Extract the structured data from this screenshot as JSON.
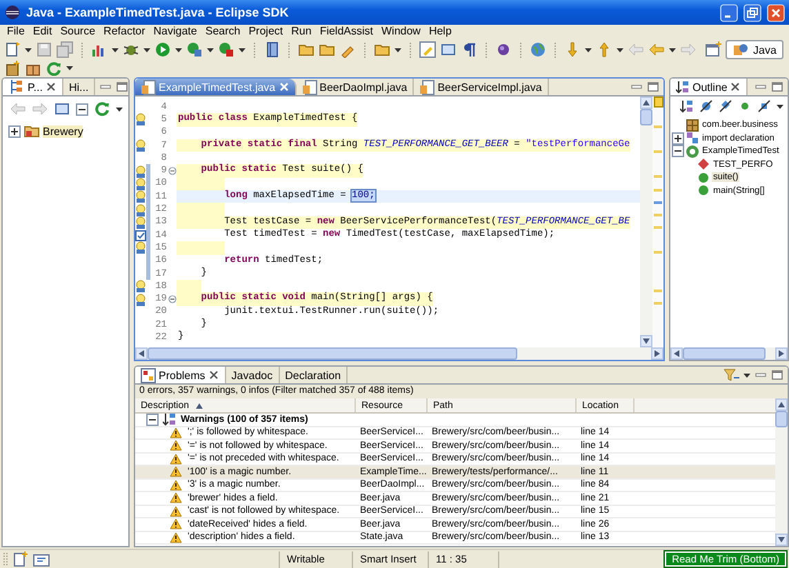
{
  "window": {
    "title": "Java - ExampleTimedTest.java - Eclipse SDK"
  },
  "menu": [
    "File",
    "Edit",
    "Source",
    "Refactor",
    "Navigate",
    "Search",
    "Project",
    "Run",
    "FieldAssist",
    "Window",
    "Help"
  ],
  "perspective": {
    "label": "Java",
    "selected": true
  },
  "package_explorer": {
    "tabs": [
      {
        "label": "P...",
        "selected": true
      },
      {
        "label": "Hi...",
        "selected": false
      }
    ],
    "tree": [
      {
        "label": "Brewery",
        "expanded": false,
        "selected": true
      }
    ]
  },
  "editor": {
    "tabs": [
      {
        "label": "ExampleTimedTest.java",
        "selected": true
      },
      {
        "label": "BeerDaoImpl.java",
        "selected": false
      },
      {
        "label": "BeerServiceImpl.java",
        "selected": false
      }
    ],
    "lines": [
      {
        "number": "4",
        "warning": false,
        "current": false,
        "warning_marker": false,
        "task_marker": false,
        "fold": false,
        "in_range": false
      },
      {
        "number": "5",
        "warning": true,
        "current": false,
        "warning_marker": true,
        "task_marker": false,
        "fold": false,
        "in_range": false,
        "kind": "class",
        "segments": [
          {
            "text": "public class",
            "kind": "keyword"
          },
          {
            "text": " ExampleTimedTest {",
            "kind": "plain"
          }
        ]
      },
      {
        "number": "6",
        "warning": false,
        "current": false,
        "warning_marker": false,
        "task_marker": false,
        "fold": false,
        "in_range": false
      },
      {
        "number": "7",
        "warning": true,
        "current": false,
        "warning_marker": true,
        "task_marker": false,
        "fold": false,
        "in_range": false,
        "kind": "member",
        "segments": [
          {
            "text": "private static final",
            "kind": "keyword"
          },
          {
            "text": " String ",
            "kind": "plain"
          },
          {
            "text": "TEST_PERFORMANCE_GET_BEER",
            "kind": "constant"
          },
          {
            "text": " = ",
            "kind": "plain"
          },
          {
            "text": "\"testPerformanceGe",
            "kind": "string"
          }
        ]
      },
      {
        "number": "8",
        "warning": false,
        "current": false,
        "warning_marker": false,
        "task_marker": false,
        "fold": false,
        "in_range": false
      },
      {
        "number": "9",
        "warning": true,
        "current": false,
        "warning_marker": true,
        "task_marker": false,
        "fold": true,
        "in_range": true,
        "kind": "member",
        "segments": [
          {
            "text": "public static",
            "kind": "keyword"
          },
          {
            "text": " Test suite() {",
            "kind": "plain"
          }
        ]
      },
      {
        "number": "10",
        "warning": true,
        "current": false,
        "warning_marker": true,
        "task_marker": false,
        "fold": false,
        "in_range": true,
        "kind": "statement"
      },
      {
        "number": "11",
        "warning": false,
        "current": true,
        "warning_marker": true,
        "task_marker": false,
        "fold": false,
        "in_range": true,
        "kind": "statement",
        "segments": [
          {
            "text": "long",
            "kind": "keyword"
          },
          {
            "text": " maxElapsedTime = ",
            "kind": "plain"
          },
          {
            "text": "100;",
            "kind": "selected"
          }
        ]
      },
      {
        "number": "12",
        "warning": true,
        "current": false,
        "warning_marker": true,
        "task_marker": false,
        "fold": false,
        "in_range": true,
        "kind": "statement"
      },
      {
        "number": "13",
        "warning": true,
        "current": false,
        "warning_marker": true,
        "task_marker": false,
        "fold": false,
        "in_range": true,
        "kind": "statement",
        "segments": [
          {
            "text": "Test testCase = ",
            "kind": "plain"
          },
          {
            "text": "new",
            "kind": "keyword"
          },
          {
            "text": " BeerServicePerformanceTest(",
            "kind": "plain"
          },
          {
            "text": "TEST_PERFORMANCE_GET_BE",
            "kind": "constant"
          }
        ]
      },
      {
        "number": "14",
        "warning": false,
        "current": false,
        "warning_marker": false,
        "task_marker": true,
        "fold": false,
        "in_range": true,
        "kind": "statement",
        "segments": [
          {
            "text": "Test timedTest = ",
            "kind": "plain"
          },
          {
            "text": "new",
            "kind": "keyword"
          },
          {
            "text": " TimedTest(testCase, maxElapsedTime);",
            "kind": "plain"
          }
        ]
      },
      {
        "number": "15",
        "warning": true,
        "current": false,
        "warning_marker": true,
        "task_marker": false,
        "fold": false,
        "in_range": true,
        "kind": "statement"
      },
      {
        "number": "16",
        "warning": false,
        "current": false,
        "warning_marker": false,
        "task_marker": false,
        "fold": false,
        "in_range": true,
        "kind": "statement",
        "segments": [
          {
            "text": "return",
            "kind": "keyword"
          },
          {
            "text": " timedTest;",
            "kind": "plain"
          }
        ]
      },
      {
        "number": "17",
        "warning": false,
        "current": false,
        "warning_marker": false,
        "task_marker": false,
        "fold": false,
        "in_range": true,
        "kind": "member",
        "segments": [
          {
            "text": "}",
            "kind": "plain"
          }
        ]
      },
      {
        "number": "18",
        "warning": true,
        "current": false,
        "warning_marker": true,
        "task_marker": false,
        "fold": false,
        "in_range": false,
        "kind": "member"
      },
      {
        "number": "19",
        "warning": true,
        "current": false,
        "warning_marker": true,
        "task_marker": false,
        "fold": true,
        "in_range": false,
        "kind": "member",
        "segments": [
          {
            "text": "public static void",
            "kind": "keyword"
          },
          {
            "text": " main(String[] args) {",
            "kind": "plain"
          }
        ]
      },
      {
        "number": "20",
        "warning": false,
        "current": false,
        "warning_marker": false,
        "task_marker": false,
        "fold": false,
        "in_range": false,
        "kind": "statement",
        "segments": [
          {
            "text": "junit.textui.TestRunner.run(suite());",
            "kind": "plain"
          }
        ]
      },
      {
        "number": "21",
        "warning": false,
        "current": false,
        "warning_marker": false,
        "task_marker": false,
        "fold": false,
        "in_range": false,
        "kind": "member",
        "segments": [
          {
            "text": "}",
            "kind": "plain"
          }
        ]
      },
      {
        "number": "22",
        "warning": false,
        "current": false,
        "warning_marker": false,
        "task_marker": false,
        "fold": false,
        "in_range": false,
        "kind": "class",
        "segments": [
          {
            "text": "}",
            "kind": "plain"
          }
        ]
      }
    ]
  },
  "outline": {
    "tabs": [
      {
        "label": "Outline",
        "selected": true
      }
    ],
    "tree": [
      {
        "label": "com.beer.business",
        "kind": "package",
        "selected": false
      },
      {
        "label": "import declaration",
        "kind": "imports",
        "expanded": false,
        "selected": false
      },
      {
        "label": "ExampleTimedTest",
        "kind": "class",
        "expanded": true,
        "selected": false,
        "children": [
          {
            "label": "TEST_PERFO",
            "kind": "field",
            "selected": false
          },
          {
            "label": "suite()",
            "kind": "method",
            "selected": true
          },
          {
            "label": "main(String[]",
            "kind": "method",
            "selected": false
          }
        ]
      }
    ]
  },
  "problems": {
    "tabs": [
      {
        "label": "Problems",
        "selected": true
      },
      {
        "label": "Javadoc",
        "selected": false
      },
      {
        "label": "Declaration",
        "selected": false
      }
    ],
    "summary": "0 errors, 357 warnings, 0 infos (Filter matched 357 of 488 items)",
    "columns": [
      {
        "label": "Description",
        "sorted": true
      },
      {
        "label": "Resource",
        "sorted": false
      },
      {
        "label": "Path",
        "sorted": false
      },
      {
        "label": "Location",
        "sorted": false
      }
    ],
    "groups": [
      {
        "label": "Warnings (100 of 357 items)",
        "expanded": true,
        "rows": [
          {
            "description": "';' is followed by whitespace.",
            "resource": "BeerServiceI...",
            "path": "Brewery/src/com/beer/busin...",
            "location": "line 14",
            "selected": false
          },
          {
            "description": "'=' is not followed by whitespace.",
            "resource": "BeerServiceI...",
            "path": "Brewery/src/com/beer/busin...",
            "location": "line 14",
            "selected": false
          },
          {
            "description": "'=' is not preceded with whitespace.",
            "resource": "BeerServiceI...",
            "path": "Brewery/src/com/beer/busin...",
            "location": "line 14",
            "selected": false
          },
          {
            "description": "'100' is a magic number.",
            "resource": "ExampleTime...",
            "path": "Brewery/tests/performance/...",
            "location": "line 11",
            "selected": true
          },
          {
            "description": "'3' is a magic number.",
            "resource": "BeerDaoImpl...",
            "path": "Brewery/src/com/beer/busin...",
            "location": "line 84",
            "selected": false
          },
          {
            "description": "'brewer' hides a field.",
            "resource": "Beer.java",
            "path": "Brewery/src/com/beer/busin...",
            "location": "line 21",
            "selected": false
          },
          {
            "description": "'cast' is not followed by whitespace.",
            "resource": "BeerServiceI...",
            "path": "Brewery/src/com/beer/busin...",
            "location": "line 15",
            "selected": false
          },
          {
            "description": "'dateReceived' hides a field.",
            "resource": "Beer.java",
            "path": "Brewery/src/com/beer/busin...",
            "location": "line 26",
            "selected": false
          },
          {
            "description": "'description' hides a field.",
            "resource": "State.java",
            "path": "Brewery/src/com/beer/busin...",
            "location": "line 13",
            "selected": false
          }
        ]
      }
    ]
  },
  "status_bar": {
    "writable": "Writable",
    "insert_mode": "Smart Insert",
    "position": "11 : 35",
    "trim": "Read Me Trim (Bottom)"
  }
}
